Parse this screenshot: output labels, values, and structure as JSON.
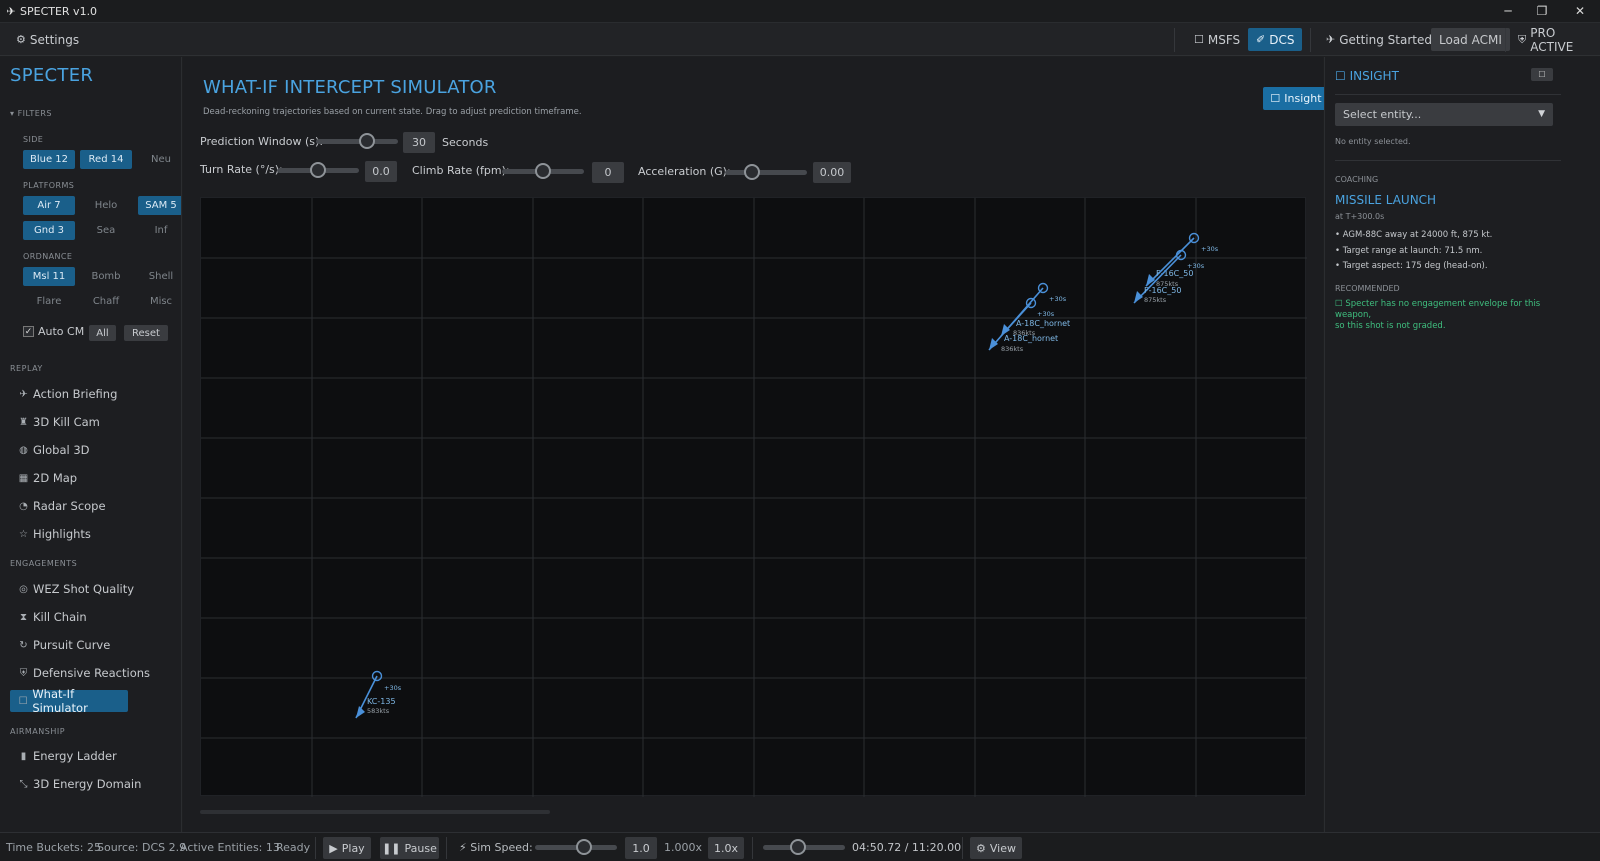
{
  "window": {
    "title": "SPECTER v1.0",
    "minimize": "─",
    "maximize": "❐",
    "close": "✕"
  },
  "menubar": {
    "settings": "Settings",
    "msfs": "MSFS",
    "dcs": "DCS",
    "getting_started": "Getting Started",
    "load_acmi": "Load ACMI",
    "pro": "PRO ACTIVE"
  },
  "sidebar": {
    "brand": "SPECTER",
    "filters_label": "FILTERS",
    "side_label": "SIDE",
    "side": [
      {
        "label": "Blue 12",
        "on": true
      },
      {
        "label": "Red 14",
        "on": true
      },
      {
        "label": "Neu",
        "on": false
      }
    ],
    "platforms_label": "PLATFORMS",
    "platforms_row1": [
      {
        "label": "Air 7",
        "on": true
      },
      {
        "label": "Helo",
        "on": false
      },
      {
        "label": "SAM 5",
        "on": true
      }
    ],
    "platforms_row2": [
      {
        "label": "Gnd 3",
        "on": true
      },
      {
        "label": "Sea",
        "on": false
      },
      {
        "label": "Inf",
        "on": false
      }
    ],
    "ordnance_label": "ORDNANCE",
    "ordnance_row1": [
      {
        "label": "Msl 11",
        "on": true
      },
      {
        "label": "Bomb",
        "on": false
      },
      {
        "label": "Shell",
        "on": false
      }
    ],
    "ordnance_row2": [
      {
        "label": "Flare",
        "on": false
      },
      {
        "label": "Chaff",
        "on": false
      },
      {
        "label": "Misc",
        "on": false
      }
    ],
    "auto_cm": "Auto CM",
    "all": "All",
    "reset": "Reset",
    "replay_label": "REPLAY",
    "replay": [
      "Action Briefing",
      "3D Kill Cam",
      "Global 3D",
      "2D Map",
      "Radar Scope",
      "Highlights"
    ],
    "engagements_label": "ENGAGEMENTS",
    "engagements": [
      "WEZ Shot Quality",
      "Kill Chain",
      "Pursuit Curve",
      "Defensive Reactions",
      "What-If Simulator"
    ],
    "airmanship_label": "AIRMANSHIP",
    "airmanship": [
      "Energy Ladder",
      "3D Energy Domain"
    ]
  },
  "main": {
    "title": "WHAT-IF INTERCEPT SIMULATOR",
    "subtitle": "Dead-reckoning trajectories based on current state. Drag to adjust prediction timeframe.",
    "insight_button": "Insight",
    "prediction_label": "Prediction Window (s):",
    "prediction_value": "30",
    "prediction_unit": "Seconds",
    "prediction_fraction": 0.62,
    "turn_label": "Turn Rate (°/s):",
    "turn_value": "0.0",
    "turn_fraction": 0.5,
    "climb_label": "Climb Rate (fpm):",
    "climb_value": "0",
    "climb_fraction": 0.5,
    "accel_label": "Acceleration (G):",
    "accel_value": "0.00",
    "accel_fraction": 0.33
  },
  "plot": {
    "tracks": [
      {
        "name": "A-18C_hornet",
        "speed": "836kts",
        "pred": "+30s",
        "color": "#4a90d9"
      },
      {
        "name": "A-18C_hornet",
        "speed": "836kts",
        "pred": "+30s",
        "color": "#4a90d9"
      },
      {
        "name": "F-16C_50",
        "speed": "875kts",
        "pred": "+30s",
        "color": "#4a90d9"
      },
      {
        "name": "F-16C_50",
        "speed": "875kts",
        "pred": "+30s",
        "color": "#4a90d9"
      },
      {
        "name": "KC-135",
        "speed": "583kts",
        "pred": "+30s",
        "color": "#4a90d9"
      }
    ]
  },
  "insight": {
    "title": "INSIGHT",
    "select_placeholder": "Select entity...",
    "no_entity": "No entity selected.",
    "coaching_label": "COACHING",
    "event_title": "MISSILE LAUNCH",
    "event_time": "at T+300.0s",
    "bullets": [
      "• AGM-88C away at 24000 ft, 875 kt.",
      "• Target range at launch: 71.5 nm.",
      "• Target aspect: 175 deg (head-on)."
    ],
    "recommended_label": "RECOMMENDED",
    "recommended_text_1": "Specter has no engagement envelope for this weapon,",
    "recommended_text_2": "so this shot is not graded."
  },
  "status": {
    "time_buckets": "Time Buckets: 25",
    "source": "Source: DCS 2.9",
    "active": "Active Entities: 13",
    "ready": "Ready",
    "play": "Play",
    "pause": "Pause",
    "sim_speed_label": "Sim Speed:",
    "sim_speed_value": "1.0",
    "sim_speed_mult": "1.000x",
    "sim_speed_btn": "1.0x",
    "sim_speed_fraction": 0.6,
    "time_fraction": 0.43,
    "time": "04:50.72 / 11:20.00",
    "view": "View"
  }
}
